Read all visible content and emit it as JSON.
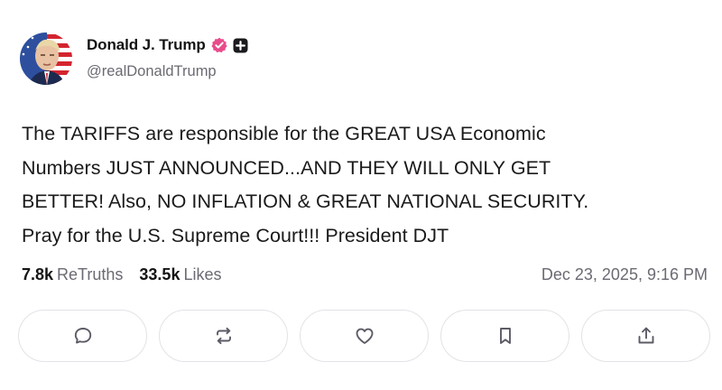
{
  "author": {
    "display_name": "Donald J. Trump",
    "handle": "@realDonaldTrump",
    "avatar_icon": "avatar-portrait-flag",
    "verified_icon": "verified-badge-icon",
    "verified_color": "#e94b8a",
    "extra_badge_icon": "plus-square-icon"
  },
  "post": {
    "lines": [
      "The TARIFFS are responsible for the GREAT USA Economic",
      "Numbers JUST ANNOUNCED...AND THEY WILL ONLY GET",
      "BETTER! Also, NO INFLATION & GREAT NATIONAL SECURITY.",
      "Pray for the U.S. Supreme Court!!! President DJT"
    ]
  },
  "stats": {
    "retruths_count": "7.8k",
    "retruths_label": "ReTruths",
    "likes_count": "33.5k",
    "likes_label": "Likes",
    "timestamp": "Dec 23, 2025, 9:16 PM"
  },
  "actions": [
    {
      "name": "reply",
      "icon": "comment-bubble-icon"
    },
    {
      "name": "retruth",
      "icon": "repost-arrows-icon"
    },
    {
      "name": "like",
      "icon": "heart-icon"
    },
    {
      "name": "bookmark",
      "icon": "bookmark-icon"
    },
    {
      "name": "share",
      "icon": "share-upload-icon"
    }
  ],
  "colors": {
    "text_primary": "#141414",
    "text_secondary": "#6a6a73",
    "button_border": "#e3e3e8"
  }
}
